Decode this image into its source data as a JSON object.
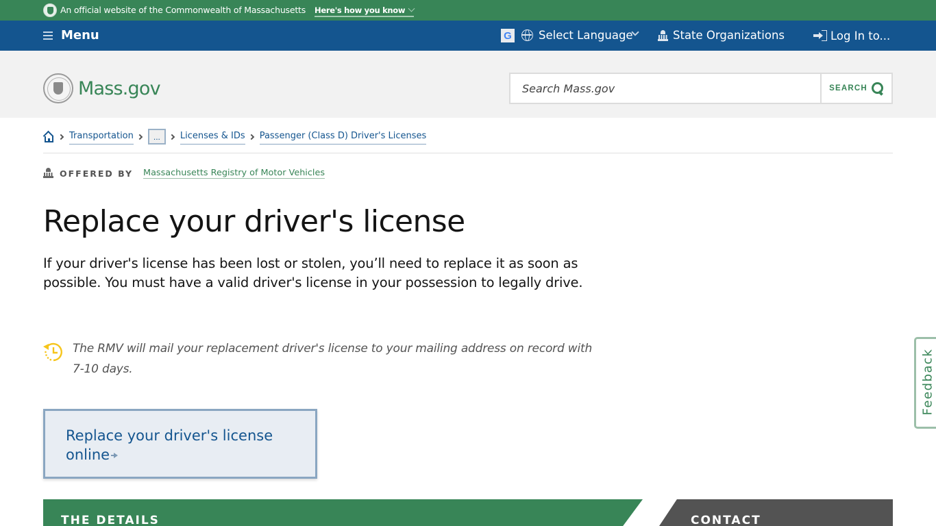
{
  "official_banner": {
    "text": "An official website of the Commonwealth of Massachusetts",
    "how_you_know_link": "Here's how you know"
  },
  "utility_nav": {
    "menu_label": "Menu",
    "google_icon_letter": "G",
    "language_label": "Select Language",
    "state_orgs_label": "State Organizations",
    "login_label": "Log In to..."
  },
  "header": {
    "logo_text": "Mass.gov",
    "search_placeholder": "Search Mass.gov",
    "search_button_label": "SEARCH"
  },
  "breadcrumbs": {
    "items": [
      {
        "label": "Transportation"
      },
      {
        "label": "..."
      },
      {
        "label": "Licenses & IDs"
      },
      {
        "label": "Passenger (Class D) Driver's Licenses"
      }
    ]
  },
  "offered_by": {
    "label": "OFFERED BY",
    "organization": "Massachusetts Registry of Motor Vehicles"
  },
  "page": {
    "title": "Replace your driver's license",
    "lede": "If your driver's license has been lost or stolen, you’ll need to replace it as soon as possible. You must have a valid driver's license in your possession to legally drive.",
    "callout": "The RMV will mail your replacement driver's license to your mailing address on record with 7-10 days.",
    "cta_label": "Replace your driver's license online"
  },
  "sections": {
    "details_title": "THE DETAILS",
    "contact_title": "CONTACT"
  },
  "feedback_label": "Feedback",
  "colors": {
    "brand_green": "#388557",
    "nav_blue": "#14558f",
    "callout_icon_yellow": "#f6c51b",
    "contact_gray": "#535353"
  }
}
